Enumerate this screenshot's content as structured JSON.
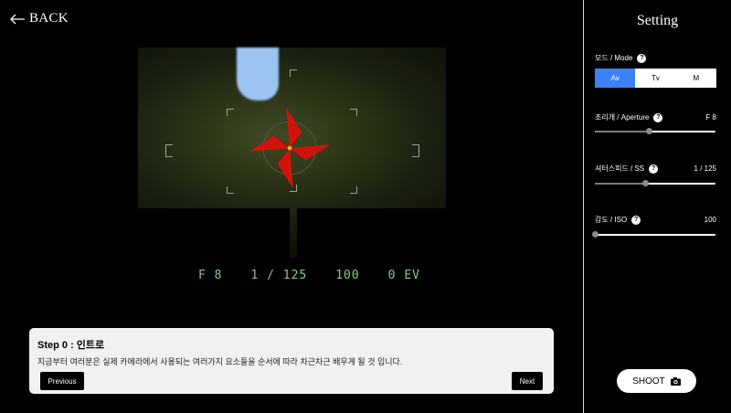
{
  "nav": {
    "back_label": "BACK"
  },
  "camera": {
    "readout": {
      "aperture": "F 8",
      "shutter": "1 / 125",
      "iso": "100",
      "ev": "0 EV"
    }
  },
  "tutorial": {
    "title": "Step 0 : 인트로",
    "text": "지금부터 여러분은 실제 카메라에서 사용되는 여러가지 요소들을 순서에 따라 차근차근 배우게 될 것 입니다.",
    "prev_label": "Previous",
    "next_label": "Next"
  },
  "settings": {
    "title": "Setting",
    "mode": {
      "label": "모드 / Mode",
      "options": [
        "Av",
        "Tv",
        "M"
      ],
      "selected": "Av"
    },
    "aperture": {
      "label": "조리개 / Aperture",
      "value": "F 8",
      "level": 0.45
    },
    "shutter": {
      "label": "셔터스피드 / SS",
      "value": "1 / 125",
      "level": 0.42
    },
    "iso": {
      "label": "감도 / ISO",
      "value": "100",
      "level": 0.0
    },
    "help_glyph": "?",
    "shoot_label": "SHOOT"
  },
  "colors": {
    "accent": "#3b82f6",
    "readout": "#7fd27a",
    "pinwheel": "#d0140c"
  },
  "icons": [
    "arrow-left-icon",
    "help-icon",
    "camera-icon"
  ]
}
